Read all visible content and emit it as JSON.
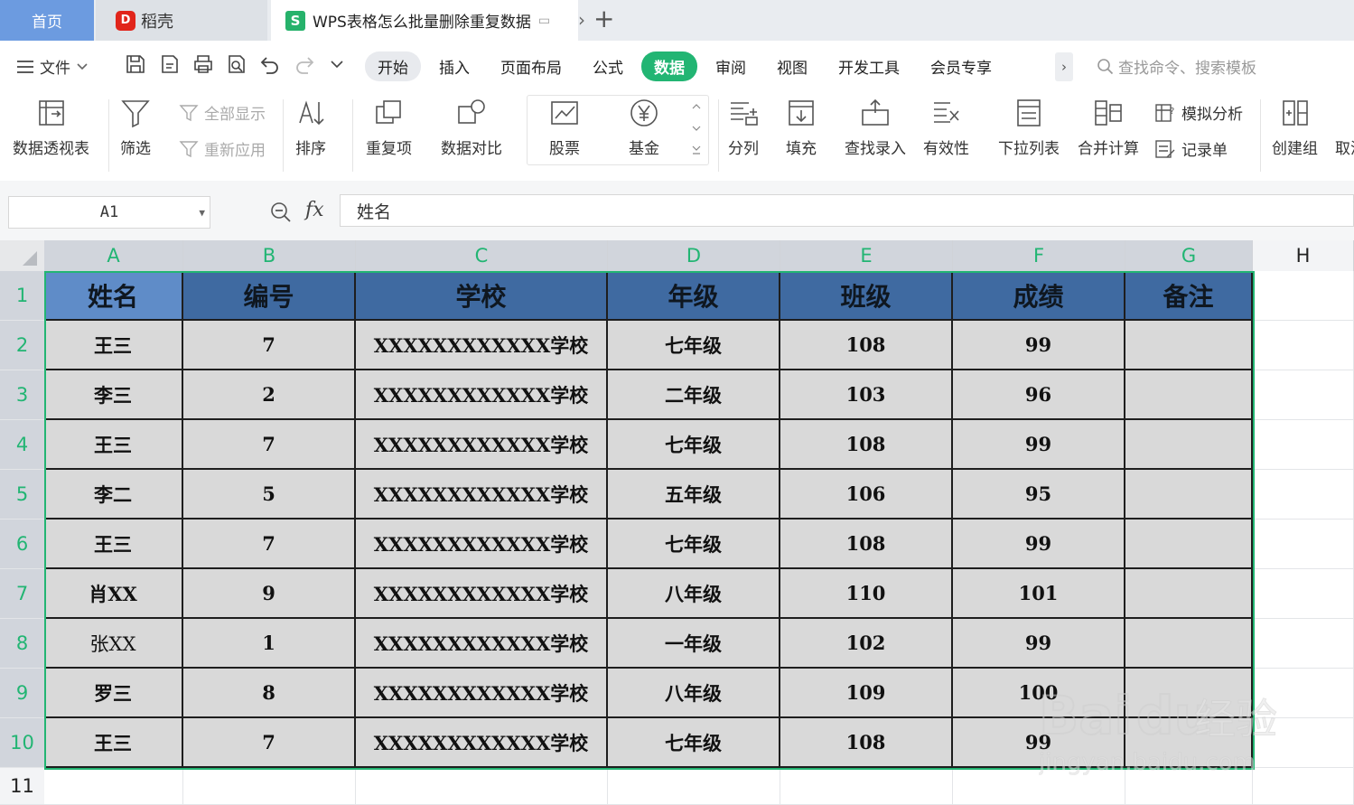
{
  "tabs": {
    "home": "首页",
    "daoke": "稻壳",
    "daoke_logo": "D",
    "doc_logo": "S",
    "doc_title": "WPS表格怎么批量删除重复数据"
  },
  "menu": {
    "file": "文件",
    "tabs": [
      "开始",
      "插入",
      "页面布局",
      "公式",
      "数据",
      "审阅",
      "视图",
      "开发工具",
      "会员专享"
    ],
    "active_tab": "数据",
    "more": "›",
    "search_placeholder": "查找命令、搜索模板"
  },
  "ribbon": {
    "pivot": "数据透视表",
    "filter": "筛选",
    "show_all": "全部显示",
    "reapply": "重新应用",
    "sort": "排序",
    "duplicates": "重复项",
    "compare": "数据对比",
    "stock": "股票",
    "fund": "基金",
    "split": "分列",
    "fill": "填充",
    "lookup": "查找录入",
    "validity": "有效性",
    "dropdown": "下拉列表",
    "consolidate": "合并计算",
    "simulate": "模拟分析",
    "record": "记录单",
    "group": "创建组",
    "ungroup": "取消"
  },
  "formula_bar": {
    "cell_ref": "A1",
    "fx": "fx",
    "content": "姓名"
  },
  "sheet": {
    "columns": [
      "A",
      "B",
      "C",
      "D",
      "E",
      "F",
      "G",
      "H"
    ],
    "rows": [
      "1",
      "2",
      "3",
      "4",
      "5",
      "6",
      "7",
      "8",
      "9",
      "10",
      "11"
    ],
    "header": [
      "姓名",
      "编号",
      "学校",
      "年级",
      "班级",
      "成绩",
      "备注"
    ],
    "data": [
      [
        "王三",
        "7",
        "XXXXXXXXXXXX学校",
        "七年级",
        "108",
        "99",
        ""
      ],
      [
        "李三",
        "2",
        "XXXXXXXXXXXX学校",
        "二年级",
        "103",
        "96",
        ""
      ],
      [
        "王三",
        "7",
        "XXXXXXXXXXXX学校",
        "七年级",
        "108",
        "99",
        ""
      ],
      [
        "李二",
        "5",
        "XXXXXXXXXXXX学校",
        "五年级",
        "106",
        "95",
        ""
      ],
      [
        "王三",
        "7",
        "XXXXXXXXXXXX学校",
        "七年级",
        "108",
        "99",
        ""
      ],
      [
        "肖XX",
        "9",
        "XXXXXXXXXXXX学校",
        "八年级",
        "110",
        "101",
        ""
      ],
      [
        "张XX",
        "1",
        "XXXXXXXXXXXX学校",
        "一年级",
        "102",
        "99",
        ""
      ],
      [
        "罗三",
        "8",
        "XXXXXXXXXXXX学校",
        "八年级",
        "109",
        "100",
        ""
      ],
      [
        "王三",
        "7",
        "XXXXXXXXXXXX学校",
        "七年级",
        "108",
        "99",
        ""
      ]
    ]
  },
  "watermark": {
    "brand": "Bai",
    "paw": "du",
    "cn": "经验",
    "url": "jingyan.baidu.com"
  },
  "colors": {
    "accent": "#22b573",
    "header_fill": "#3f6aa1",
    "data_fill": "#d9d9d9",
    "home_tab": "#6c9be0"
  }
}
